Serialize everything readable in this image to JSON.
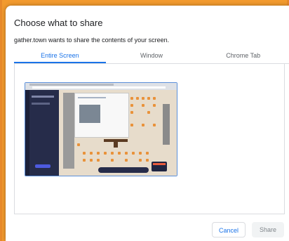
{
  "dialog": {
    "title": "Choose what to share",
    "subtitle": "gather.town wants to share the contents of your screen."
  },
  "tabs": [
    {
      "label": "Entire Screen",
      "active": true
    },
    {
      "label": "Window",
      "active": false
    },
    {
      "label": "Chrome Tab",
      "active": false
    }
  ],
  "buttons": {
    "cancel": "Cancel",
    "share": "Share"
  },
  "colors": {
    "backdrop": "#f29a2e",
    "accent": "#1a73e8"
  }
}
